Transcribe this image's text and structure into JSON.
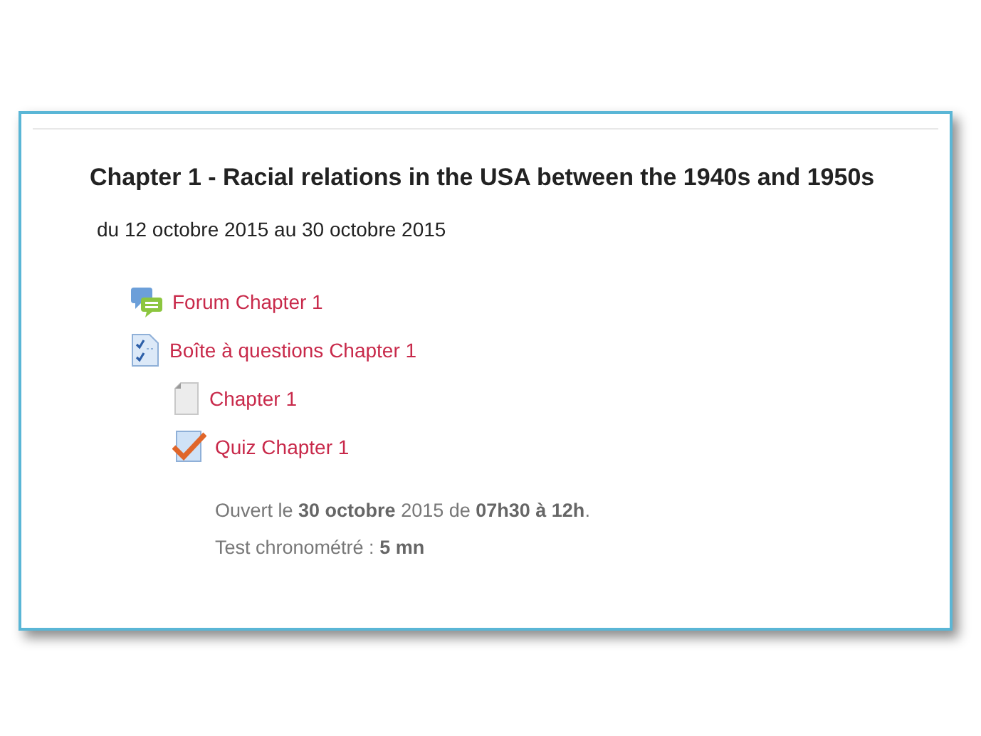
{
  "section": {
    "title": "Chapter 1 - Racial relations in the USA between the 1940s and 1950s",
    "dates": "du 12 octobre 2015 au 30 octobre 2015",
    "activities": [
      {
        "kind": "forum",
        "label": "Forum Chapter 1"
      },
      {
        "kind": "questions",
        "label": "Boîte à questions Chapter 1",
        "children": [
          {
            "kind": "page",
            "label": "Chapter 1"
          },
          {
            "kind": "quiz",
            "label": "Quiz Chapter 1",
            "details": [
              "Ouvert le **30 octobre** 2015 de **07h30 à 12h**.",
              "Test chronométré : **5 mn**"
            ]
          }
        ]
      }
    ]
  }
}
